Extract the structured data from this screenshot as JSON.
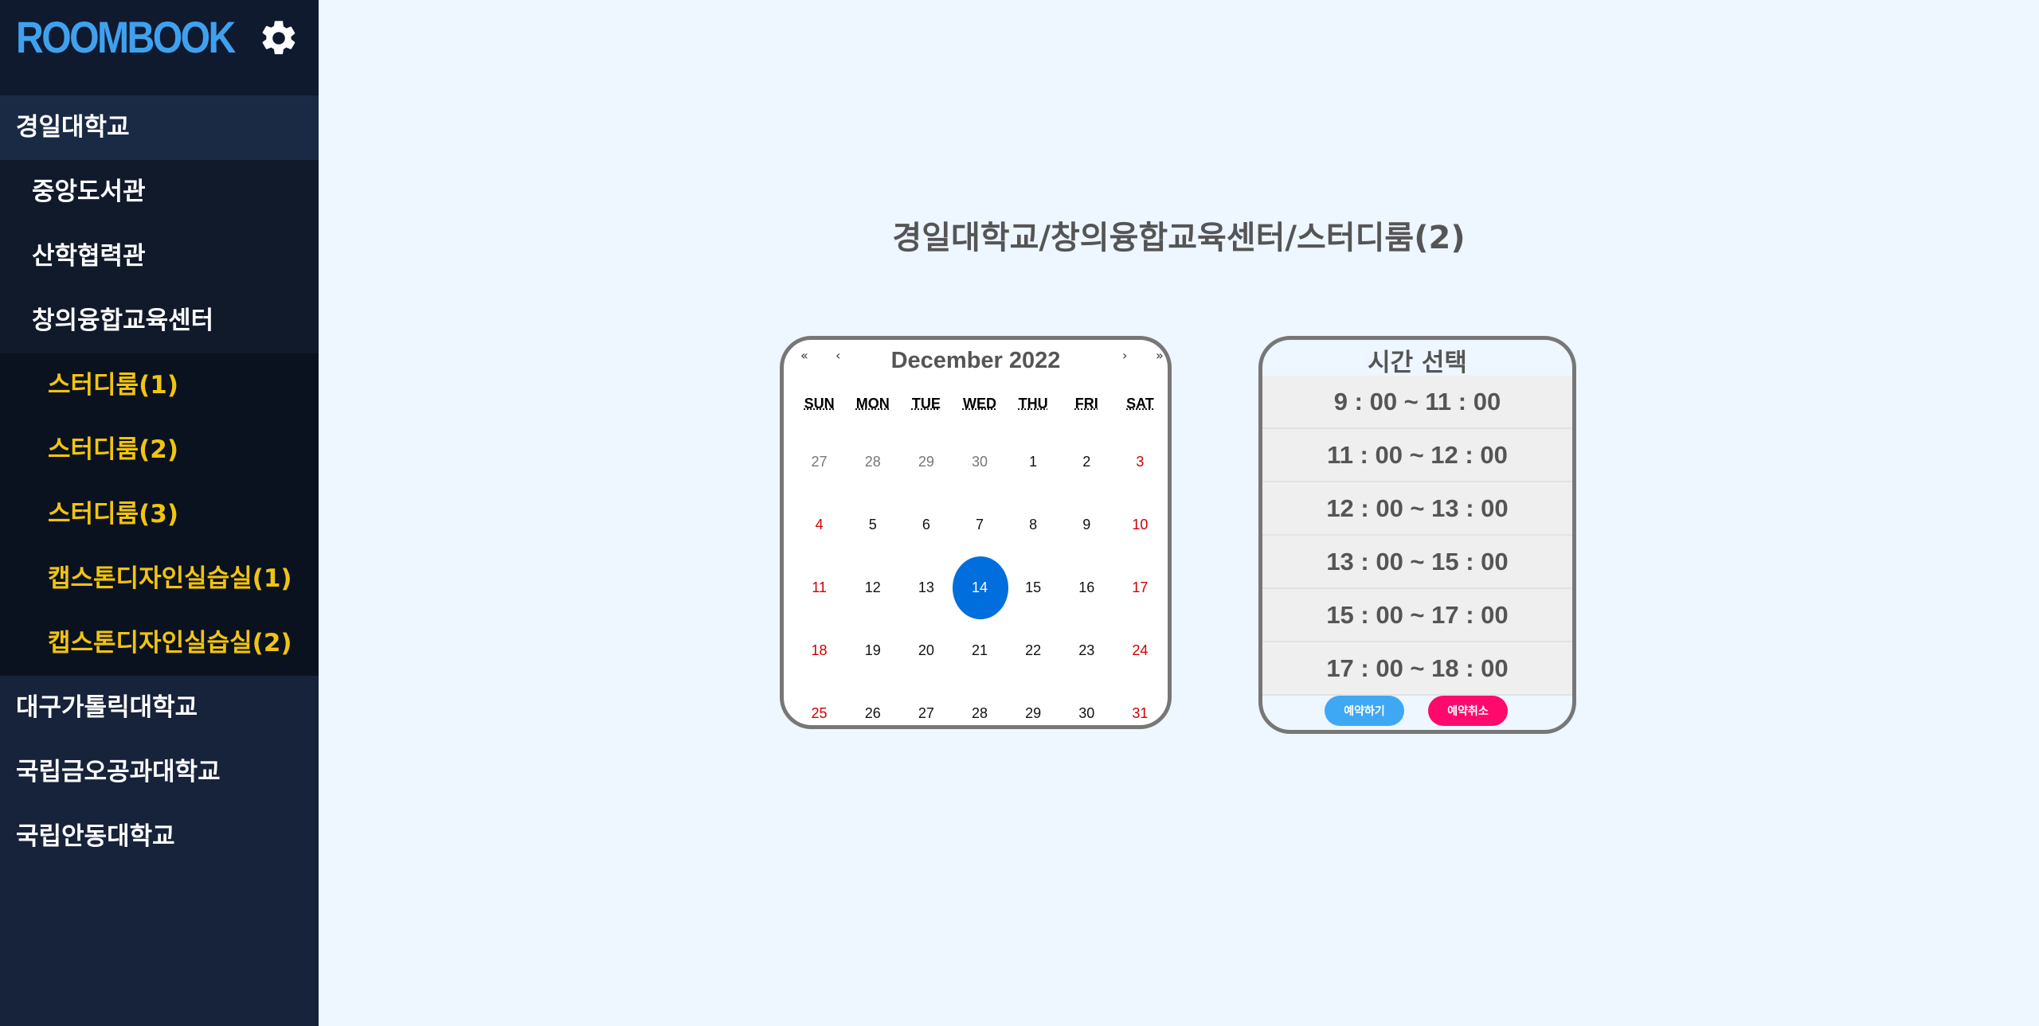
{
  "app": {
    "brand": "ROOMBOOK"
  },
  "sidebar": {
    "universities": [
      {
        "label": "경일대학교"
      },
      {
        "label": "대구가톨릭대학교"
      },
      {
        "label": "국립금오공과대학교"
      },
      {
        "label": "국립안동대학교"
      }
    ],
    "buildings": [
      {
        "label": "중앙도서관"
      },
      {
        "label": "산학협력관"
      },
      {
        "label": "창의융합교육센터"
      }
    ],
    "rooms": [
      {
        "label": "스터디룸(1)"
      },
      {
        "label": "스터디룸(2)"
      },
      {
        "label": "스터디룸(3)"
      },
      {
        "label": "캡스톤디자인실습실(1)"
      },
      {
        "label": "캡스톤디자인실습실(2)"
      }
    ]
  },
  "main": {
    "title": "경일대학교/창의융합교육센터/스터디룸(2)"
  },
  "calendar": {
    "nav": {
      "prev_year": "«",
      "prev_month": "‹",
      "next_month": "›",
      "next_year": "»"
    },
    "month_label": "December 2022",
    "weekdays": [
      "SUN",
      "MON",
      "TUE",
      "WED",
      "THU",
      "FRI",
      "SAT"
    ],
    "weeks": [
      [
        "27",
        "28",
        "29",
        "30",
        "1",
        "2",
        "3"
      ],
      [
        "4",
        "5",
        "6",
        "7",
        "8",
        "9",
        "10"
      ],
      [
        "11",
        "12",
        "13",
        "14",
        "15",
        "16",
        "17"
      ],
      [
        "18",
        "19",
        "20",
        "21",
        "22",
        "23",
        "24"
      ],
      [
        "25",
        "26",
        "27",
        "28",
        "29",
        "30",
        "31"
      ]
    ],
    "selected_day": "14",
    "colors": {
      "selected": "#006edc",
      "weekend": "#d10000"
    }
  },
  "timepanel": {
    "title": "시간 선택",
    "slots": [
      {
        "label": "9 : 00 ~ 11 : 00"
      },
      {
        "label": "11 : 00 ~ 12 : 00"
      },
      {
        "label": "12 : 00 ~ 13 : 00"
      },
      {
        "label": "13 : 00 ~ 15 : 00"
      },
      {
        "label": "15 : 00 ~ 17 : 00"
      },
      {
        "label": "17 : 00 ~ 18 : 00"
      }
    ],
    "book_label": "예약하기",
    "cancel_label": "예약취소"
  },
  "icons": {
    "settings": "gear-icon"
  }
}
